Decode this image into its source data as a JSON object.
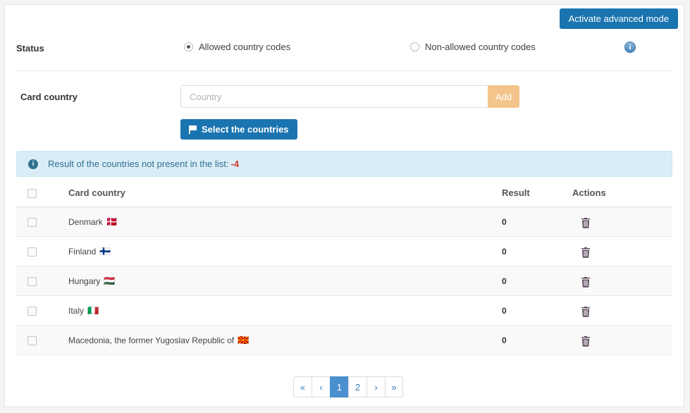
{
  "header": {
    "advanced_mode_label": "Activate advanced mode"
  },
  "status": {
    "label": "Status",
    "options": [
      {
        "label": "Allowed country codes",
        "selected": true
      },
      {
        "label": "Non-allowed country codes",
        "selected": false
      }
    ],
    "info_icon": "info-circle-icon",
    "info_glyph": "i"
  },
  "card_country": {
    "label": "Card country",
    "input_value": "",
    "input_placeholder": "Country",
    "add_label": "Add",
    "select_countries_label": "Select the countries",
    "flag_icon": "flag-icon"
  },
  "alert": {
    "icon": "info-icon",
    "icon_glyph": "i",
    "text": "Result of the countries not present in the list:",
    "count": "-4",
    "count_color": "#d9342b"
  },
  "table": {
    "columns": {
      "select_all": "select-all-checkbox",
      "card_country": "Card country",
      "result": "Result",
      "actions": "Actions"
    },
    "rows": [
      {
        "country": "Denmark",
        "flag": "🇩🇰",
        "result": "0",
        "action_icon": "trash-icon"
      },
      {
        "country": "Finland",
        "flag": "🇫🇮",
        "result": "0",
        "action_icon": "trash-icon"
      },
      {
        "country": "Hungary",
        "flag": "🇭🇺",
        "result": "0",
        "action_icon": "trash-icon"
      },
      {
        "country": "Italy",
        "flag": "🇮🇹",
        "result": "0",
        "action_icon": "trash-icon"
      },
      {
        "country": "Macedonia, the former Yugoslav Republic of",
        "flag": "🇲🇰",
        "result": "0",
        "action_icon": "trash-icon"
      }
    ]
  },
  "pagination": {
    "items": [
      {
        "label": "«",
        "name": "pagination-first",
        "active": false
      },
      {
        "label": "‹",
        "name": "pagination-prev",
        "active": false
      },
      {
        "label": "1",
        "name": "pagination-page-1",
        "active": true
      },
      {
        "label": "2",
        "name": "pagination-page-2",
        "active": false
      },
      {
        "label": "›",
        "name": "pagination-next",
        "active": false
      },
      {
        "label": "»",
        "name": "pagination-last",
        "active": false
      }
    ]
  },
  "colors": {
    "primary_blue": "#1a74b0",
    "add_orange": "#f3c58a",
    "alert_bg": "#d9edf7",
    "alert_text": "#31708f",
    "danger_red": "#d9342b",
    "pagination_active": "#4a90cf"
  }
}
